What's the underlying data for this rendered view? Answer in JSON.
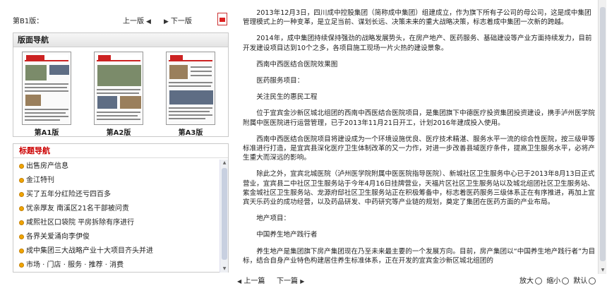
{
  "edition_bar": {
    "label": "第B1版：",
    "prev": "上一版",
    "next": "下一版"
  },
  "layout_nav": {
    "title": "版面导航",
    "pages": [
      {
        "caption": "第A1版"
      },
      {
        "caption": "第A2版"
      },
      {
        "caption": "第A3版"
      }
    ]
  },
  "title_nav": {
    "title": "标题导航",
    "items": [
      "出售房产信息",
      "金江特刊",
      "买了五年分红险还亏四百多",
      "忧亲厚友 南溪区21名干部被问责",
      "咸熙社区口袋院 平房拆除有序进行",
      "各界关爱涌向李伊俊",
      "成中集团三大战略产业十大项目齐头并进",
      "市场 · 门店 · 服务 · 推荐 · 消费"
    ]
  },
  "article": {
    "paragraphs": [
      "2013年12月3日，四川成中控股集团（简称成中集团）组建成立，作为旗下所有子公司的母公司，这是成中集团管理模式上的一种变革，是立足当前、谋划长远、决策未来的重大战略决策，标志着成中集团一次新的跨越。",
      "2014年，成中集团持续保持强劲的战略发展势头，在房产地产、医药服务、基础建设等产业方面持续发力，目前开发建设项目达到10个之多，各项目施工现场一片火热的建设景象。",
      "西南中西医结合医院效果图",
      "医药服务项目：",
      "关注民生的惠民工程",
      "位于宜宾金沙新区城北组团的西南中西医结合医院项目，是集团旗下中德医疗投资集团投资建设，携手泸州医学院附属中医医院进行运营管理，已于2013年11月21日开工，计划2016年建成投入使用。",
      "西南中西医结合医院项目将建设成为一个环境设施优良、医疗技术精湛、服务水平一流的综合性医院，按三级甲等标准进行打造，是宜宾县深化医疗卫生体制改革的又一力作，对进一步改善县域医疗条件，提高卫生服务水平，必将产生重大而深远的影响。",
      "除此之外，宜宾北城医院（泸州医学院附属中医医院指导医院）、新城社区卫生服务中心已于2013年8月13日正式营业，宜宾县二中社区卫生服务站于今年4月16日挂牌营业，天福片区社区卫生服务站以及城北组团社区卫生服务站、紫金城社区卫生服务站、龙源府邸社区卫生服务站正在积极筹备中，标志着医药服务三级体系正在有序推进，再加上宜宾天乐药业的成功经营，以及药品研发、中药研究等产业链的规划，奠定了集团在医药方面的产业布局。",
      "地产项目：",
      "中国养生地产践行者",
      "养生地产是集团旗下房产集团现在乃至未来最主要的一个发展方向。目前，房产集团以“中国养生地产践行者”为目标，结合自身产业特色构建居住养生标准体系，正在开发的宜宾金沙新区城北组团的"
    ]
  },
  "bottom_bar": {
    "prev": "上一篇",
    "next": "下一篇",
    "zoom_in": "放大",
    "zoom_out": "缩小",
    "zoom_reset": "默认"
  },
  "colors": {
    "title_nav_heading": "#cc0000",
    "bullet": "#f0a500"
  },
  "icons": [
    "pdf-icon",
    "zoom-in-icon",
    "zoom-out-icon",
    "zoom-reset-icon",
    "triangle-left-icon",
    "triangle-right-icon"
  ]
}
